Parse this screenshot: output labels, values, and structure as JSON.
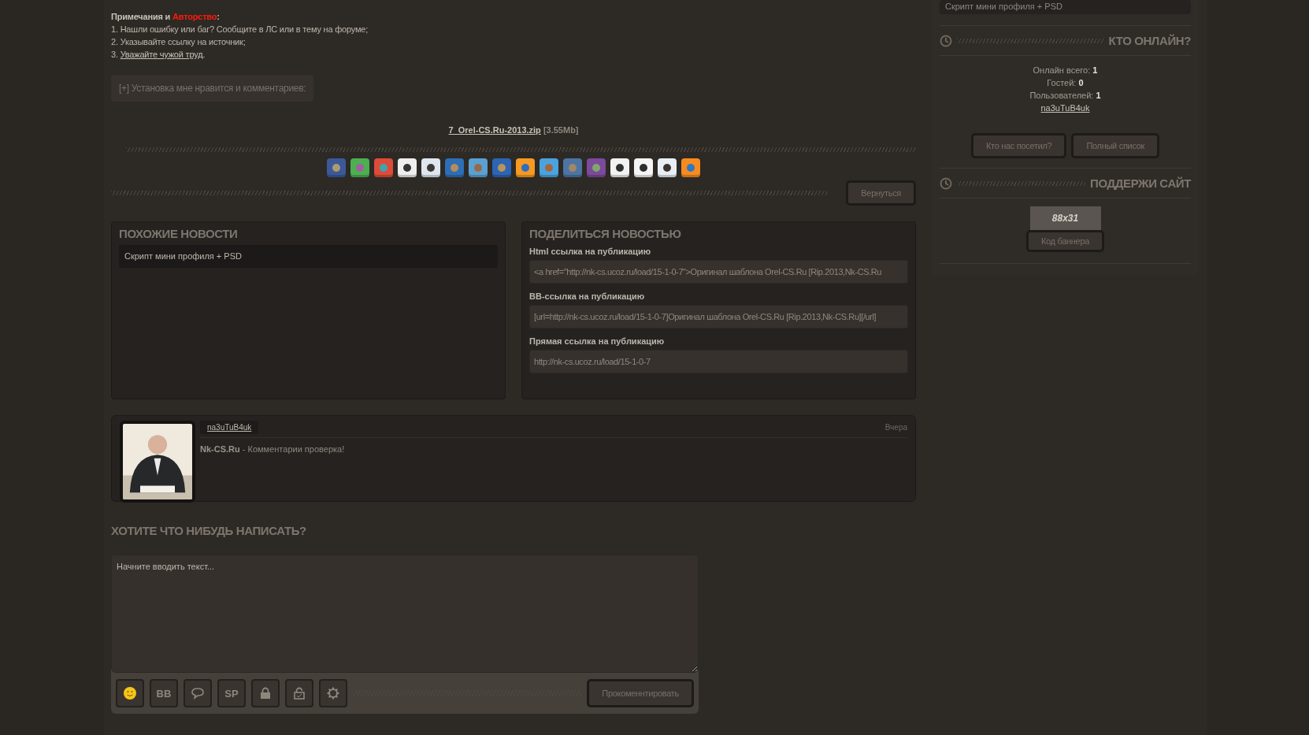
{
  "notes": {
    "heading": {
      "prefix": "Примечания и",
      "highlight": "Авторство",
      "suffix": ":"
    },
    "items": [
      {
        "text": "1. Нашли ошибку или баг? Сообщите в ЛС или в тему на форуме;"
      },
      {
        "text": "2. Указывайте ссылку на источник;"
      },
      {
        "text": "3. ",
        "link": "Уважайте чужой труд",
        "after": "."
      }
    ]
  },
  "likes_toggle": "[+] Установка мне нравится и комментариев:",
  "file": {
    "link": "7_Orel-CS.Ru-2013.zip",
    "size": "[3.55Mb]"
  },
  "share_icons": [
    {
      "color": "#3b5998"
    },
    {
      "color": "#4caf50"
    },
    {
      "color": "#dd4b39"
    },
    {
      "color": "#eeeeee"
    },
    {
      "color": "#dfe6ee"
    },
    {
      "color": "#2d6eb5"
    },
    {
      "color": "#5aa0d0"
    },
    {
      "color": "#2d64b3"
    },
    {
      "color": "#f59a23"
    },
    {
      "color": "#4aa3df"
    },
    {
      "color": "#4c75a3"
    },
    {
      "color": "#7b4a9c"
    },
    {
      "color": "#f2f2f2"
    },
    {
      "color": "#f5f5f5"
    },
    {
      "color": "#e8eef4"
    },
    {
      "color": "#f68b1f"
    }
  ],
  "back_button": "Вернуться",
  "similar": {
    "title": "ПОХОЖИЕ НОВОСТИ",
    "items": [
      "Скрипт мини профиля + PSD"
    ]
  },
  "share": {
    "title": "ПОДЕЛИТЬСЯ НОВОСТЬЮ",
    "fields": [
      {
        "label": "Html ссылка на публикацию",
        "value": "<a href=\"http://nk-cs.ucoz.ru/load/15-1-0-7\">Оригинал шаблона Orel-CS.Ru [Rip.2013,Nk-CS.Ru"
      },
      {
        "label": "BB-ссылка на публикацию",
        "value": "[url=http://nk-cs.ucoz.ru/load/15-1-0-7]Оригинал шаблона Orel-CS.Ru [Rip.2013,Nk-CS.Ru][/url]"
      },
      {
        "label": "Прямая ссылка на публикацию",
        "value": "http://nk-cs.ucoz.ru/load/15-1-0-7"
      }
    ]
  },
  "comments": [
    {
      "author": "na3uTuB4uk",
      "date": "Вчера",
      "text": "**Nk-CS.Ru** - Комментарии проверка!"
    }
  ],
  "comment_form": {
    "title": "ХОТИТЕ ЧТО НИБУДЬ НАПИСАТЬ?",
    "placeholder": "Начните вводить текст...",
    "tools": [
      {
        "kind": "smiley"
      },
      {
        "kind": "text",
        "label": "BB"
      },
      {
        "kind": "bubble"
      },
      {
        "kind": "text",
        "label": "SP"
      },
      {
        "kind": "lock"
      },
      {
        "kind": "unlock"
      },
      {
        "kind": "gear"
      }
    ],
    "submit": "Прокоменнтировать"
  },
  "sidebar": {
    "top_item": "Скрипт мини профиля + PSD",
    "online": {
      "title": "КТО ОНЛАЙН?",
      "stats": [
        "Онлайн всего: **1**",
        "Гостей: **0**",
        "Пользователей: **1**"
      ],
      "user": "na3uTuB4uk",
      "buttons": [
        "Кто нас посетил?",
        "Полный список"
      ]
    },
    "support": {
      "title": "ПОДДЕРЖИ САЙТ",
      "banner": "88x31",
      "button": "Код баннера"
    }
  }
}
